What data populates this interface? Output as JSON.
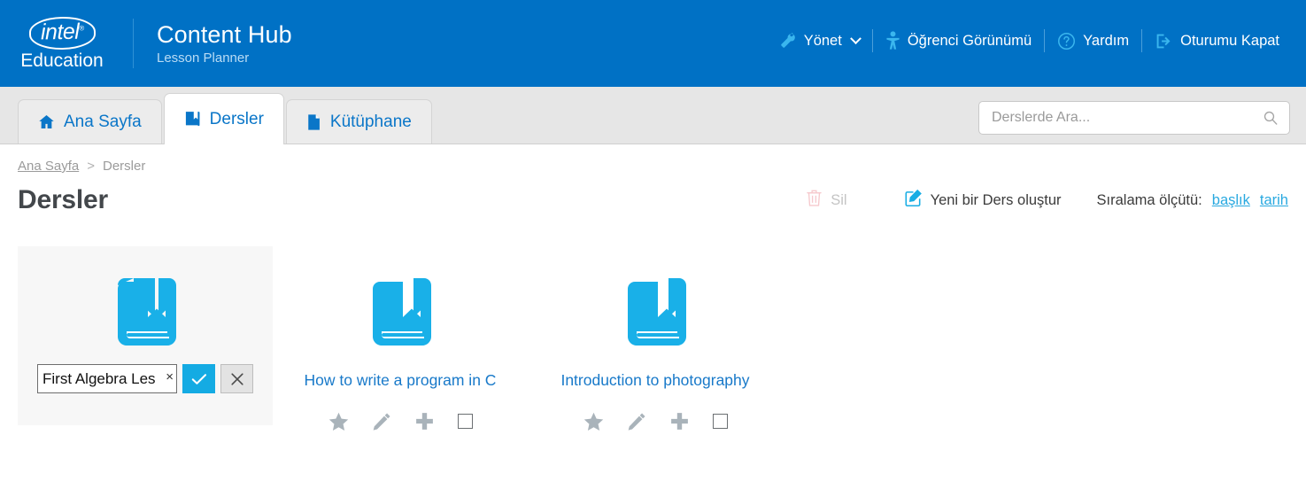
{
  "header": {
    "logo_text": "intel",
    "logo_sub": "Education",
    "app_title": "Content Hub",
    "app_subtitle": "Lesson Planner",
    "nav": [
      {
        "label": "Yönet",
        "icon": "wrench-icon",
        "has_caret": true
      },
      {
        "label": "Öğrenci Görünümü",
        "icon": "student-icon",
        "has_caret": false
      },
      {
        "label": "Yardım",
        "icon": "question-circle-icon",
        "has_caret": false
      },
      {
        "label": "Oturumu Kapat",
        "icon": "logout-icon",
        "has_caret": false
      }
    ]
  },
  "tabs": [
    {
      "label": "Ana Sayfa",
      "icon": "home-icon",
      "active": false
    },
    {
      "label": "Dersler",
      "icon": "book-icon",
      "active": true
    },
    {
      "label": "Kütüphane",
      "icon": "page-icon",
      "active": false
    }
  ],
  "search": {
    "placeholder": "Derslerde Ara...",
    "value": "",
    "icon": "search-icon"
  },
  "breadcrumb": {
    "home": "Ana Sayfa",
    "separator": ">",
    "current": "Dersler"
  },
  "page": {
    "title": "Dersler"
  },
  "toolbar": {
    "delete_label": "Sil",
    "delete_icon": "trash-icon",
    "delete_disabled": true,
    "new_lesson_label": "Yeni bir Ders oluştur",
    "new_lesson_icon": "edit-square-icon",
    "sort_label": "Sıralama ölçütü:",
    "sort_options": [
      "başlık",
      "tarih"
    ]
  },
  "cards": [
    {
      "title": "First Algebra Lesson",
      "icon": "lesson-book-icon",
      "editing": true,
      "input_value": "First Algebra Les",
      "clear_glyph": "×",
      "confirm_glyph": "✓",
      "cancel_glyph": "✕",
      "tools": []
    },
    {
      "title": "How to write a program in C",
      "icon": "lesson-book-icon",
      "editing": false,
      "tools": [
        "star-icon",
        "pencil-icon",
        "plus-icon",
        "checkbox-icon"
      ]
    },
    {
      "title": "Introduction to photography",
      "icon": "lesson-book-icon",
      "editing": false,
      "tools": [
        "star-icon",
        "pencil-icon",
        "plus-icon",
        "checkbox-icon"
      ]
    }
  ],
  "colors": {
    "header_blue": "#0071c5",
    "accent_blue": "#14abe3",
    "link_blue": "#1879c9",
    "sort_link": "#29a9e0",
    "tool_gray": "#aab4bb",
    "card_selected_bg": "#f7f7f7"
  }
}
